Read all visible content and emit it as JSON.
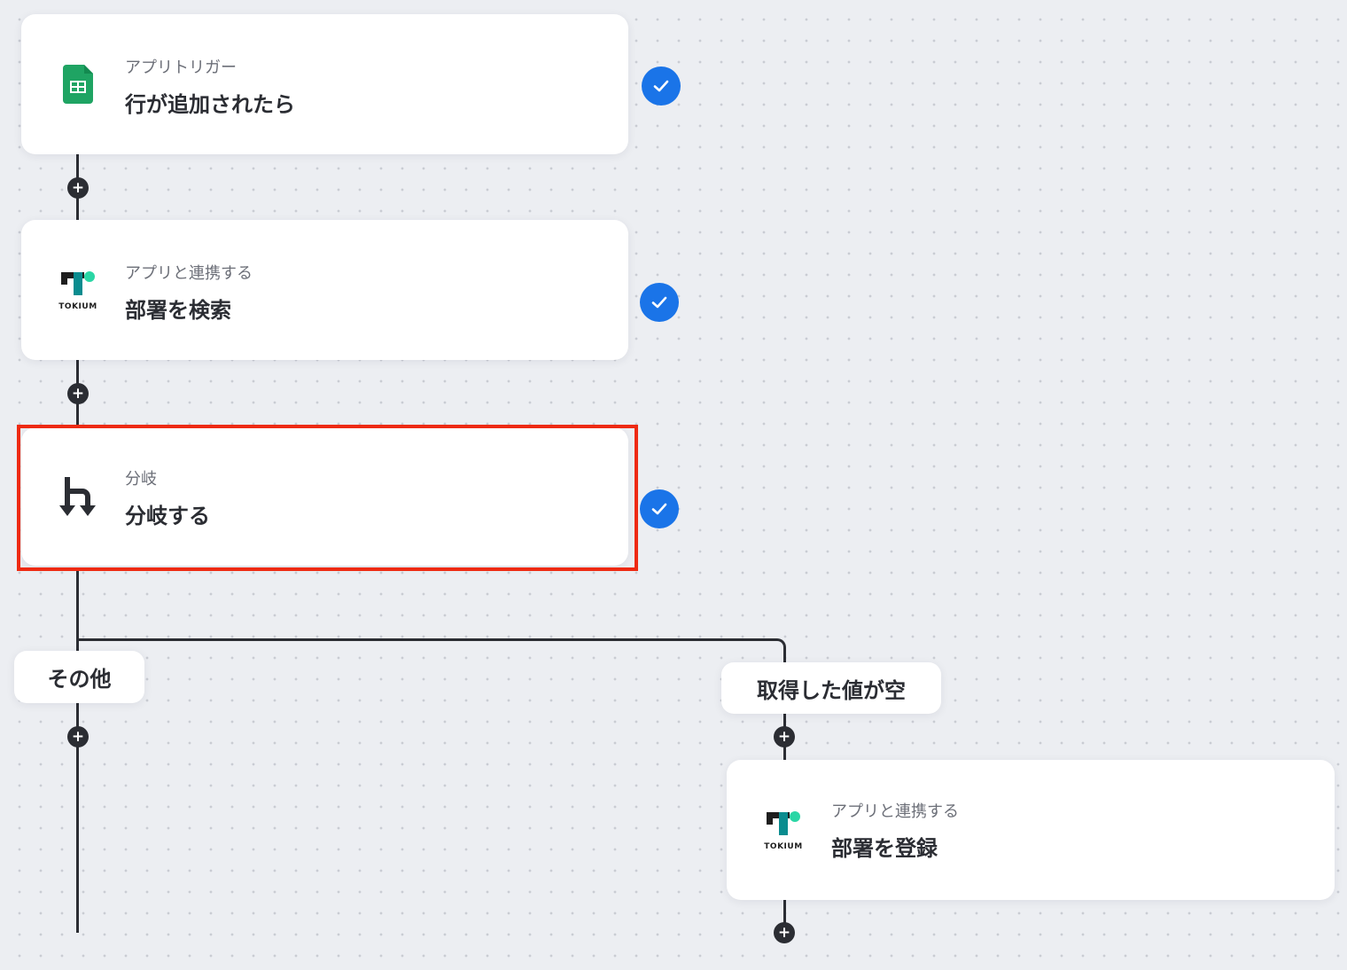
{
  "flow": {
    "steps": [
      {
        "id": "trigger",
        "subtitle": "アプリトリガー",
        "title": "行が追加されたら",
        "icon": "google-sheets-icon",
        "status": "completed"
      },
      {
        "id": "search",
        "subtitle": "アプリと連携する",
        "title": "部署を検索",
        "icon": "tokium-logo-icon",
        "logo_text": "TOKIUM",
        "status": "completed"
      },
      {
        "id": "branch",
        "subtitle": "分岐",
        "title": "分岐する",
        "icon": "branch-icon",
        "status": "completed",
        "highlighted": true
      }
    ],
    "branches": [
      {
        "label": "その他"
      },
      {
        "label": "取得した値が空"
      }
    ],
    "branch_step": {
      "subtitle": "アプリと連携する",
      "title": "部署を登録",
      "icon": "tokium-logo-icon",
      "logo_text": "TOKIUM"
    }
  },
  "colors": {
    "background": "#eceef2",
    "connector": "#2b2d33",
    "check": "#1a74e8",
    "highlight": "#ee2a12",
    "sheets_green": "#1fa463",
    "tokium_teal": "#0a8c8f",
    "tokium_dot": "#2ad6a5"
  }
}
